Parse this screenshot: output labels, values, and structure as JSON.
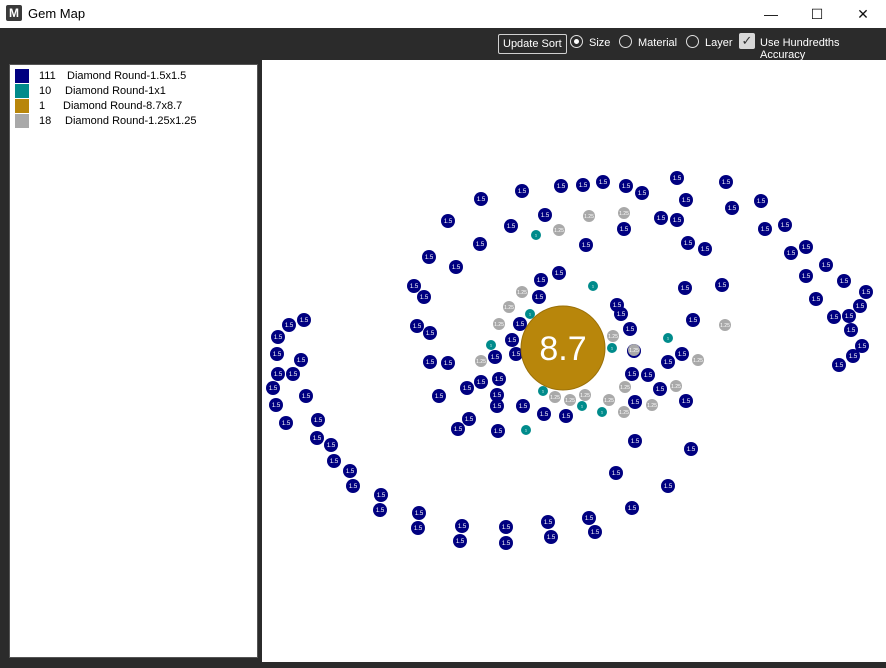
{
  "window": {
    "title": "Gem Map",
    "app_icon_letter": "M",
    "minimize_glyph": "—",
    "maximize_glyph": "☐",
    "close_glyph": "✕"
  },
  "toolbar": {
    "update_sort_label": "Update Sort",
    "sort_options": [
      {
        "label": "Size",
        "selected": true
      },
      {
        "label": "Material",
        "selected": false
      },
      {
        "label": "Layer",
        "selected": false
      }
    ],
    "hundredths_label": "Use Hundredths Accuracy",
    "hundredths_checked": true
  },
  "legend": [
    {
      "count": "111",
      "name": "Diamond Round-1.5x1.5",
      "color": "#000080"
    },
    {
      "count": "10",
      "name": "Diamond Round-1x1",
      "color": "#008b8b"
    },
    {
      "count": "1",
      "name": "Diamond Round-8.7x8.7",
      "color": "#b8860b"
    },
    {
      "count": "18",
      "name": "Diamond Round-1.25x1.25",
      "color": "#a9a9a9"
    }
  ],
  "gem_types": {
    "large": {
      "label": "1.5",
      "color": "#000080"
    },
    "small": {
      "label": "1",
      "color": "#008b8b"
    },
    "center": {
      "label": "8.7",
      "color": "#b8860b"
    },
    "medium": {
      "label": "1.25",
      "color": "#a9a9a9"
    }
  }
}
